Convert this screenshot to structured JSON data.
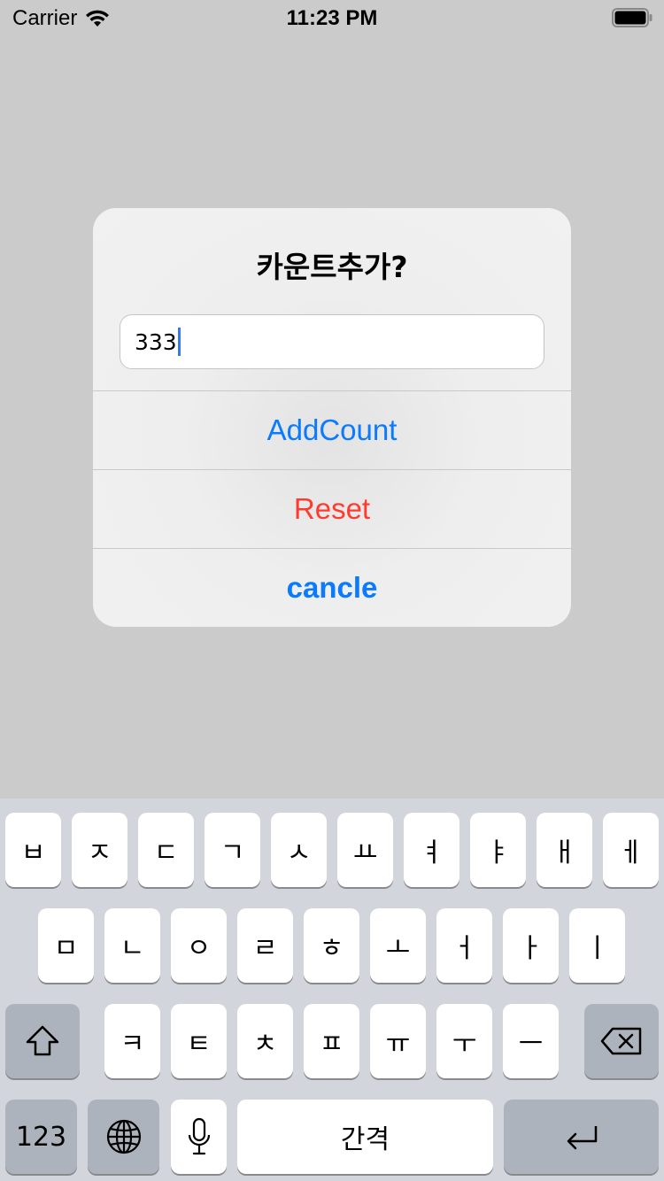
{
  "status_bar": {
    "carrier": "Carrier",
    "time": "11:23 PM"
  },
  "alert": {
    "title": "카운트추가?",
    "input_value": "333",
    "buttons": {
      "add": "AddCount",
      "reset": "Reset",
      "cancel": "cancle"
    }
  },
  "keyboard": {
    "row1": [
      "ㅂ",
      "ㅈ",
      "ㄷ",
      "ㄱ",
      "ㅅ",
      "ㅛ",
      "ㅕ",
      "ㅑ",
      "ㅐ",
      "ㅔ"
    ],
    "row2": [
      "ㅁ",
      "ㄴ",
      "ㅇ",
      "ㄹ",
      "ㅎ",
      "ㅗ",
      "ㅓ",
      "ㅏ",
      "ㅣ"
    ],
    "row3": [
      "ㅋ",
      "ㅌ",
      "ㅊ",
      "ㅍ",
      "ㅠ",
      "ㅜ",
      "ㅡ"
    ],
    "numbers_key": "123",
    "space_key": "간격"
  },
  "colors": {
    "accent": "#0a7aff",
    "destructive": "#ff3b30",
    "caret": "#3478f6"
  }
}
